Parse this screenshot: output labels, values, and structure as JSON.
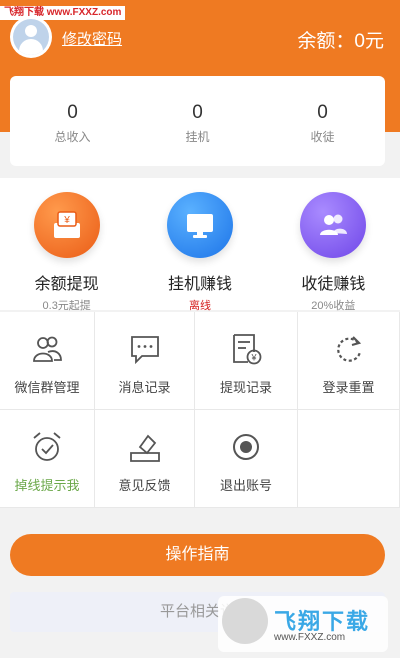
{
  "watermark_top": "飞翔下载 www.FXXZ.com",
  "header": {
    "edit_password": "修改密码",
    "balance": "余额：0元",
    "color": "#ef7a22"
  },
  "stats": [
    {
      "value": "0",
      "label": "总收入"
    },
    {
      "value": "0",
      "label": "挂机"
    },
    {
      "value": "0",
      "label": "收徒"
    }
  ],
  "features": [
    {
      "title": "余额提现",
      "subtitle": "0.3元起提",
      "icon": "wallet-icon"
    },
    {
      "title": "挂机赚钱",
      "subtitle": "离线",
      "icon": "monitor-icon"
    },
    {
      "title": "收徒赚钱",
      "subtitle": "20%收益",
      "icon": "users-icon"
    }
  ],
  "grid": [
    {
      "label": "微信群管理",
      "icon": "group-icon"
    },
    {
      "label": "消息记录",
      "icon": "message-icon"
    },
    {
      "label": "提现记录",
      "icon": "withdraw-record-icon"
    },
    {
      "label": "登录重置",
      "icon": "refresh-icon"
    },
    {
      "label": "掉线提示我",
      "icon": "alarm-clock-icon"
    },
    {
      "label": "意见反馈",
      "icon": "feedback-icon"
    },
    {
      "label": "退出账号",
      "icon": "logout-icon"
    }
  ],
  "guide_button": "操作指南",
  "platform_text": "平台相关说",
  "watermark_bottom": {
    "brand": "飞翔下载",
    "url": "www.FXXZ.com"
  }
}
